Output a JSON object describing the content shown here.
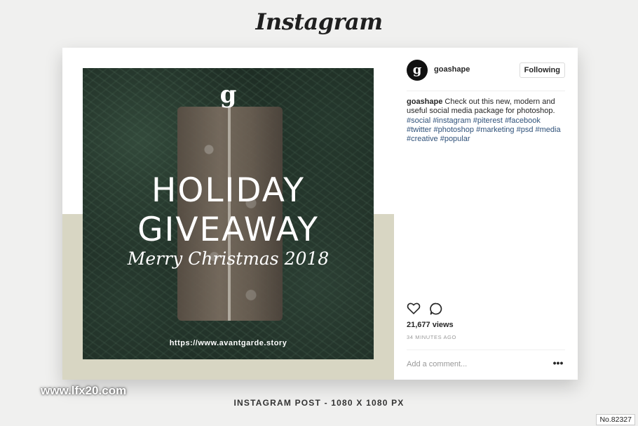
{
  "app": {
    "logo_text": "Instagram"
  },
  "post": {
    "image": {
      "brand_mark": "g",
      "headline_line1": "HOLIDAY",
      "headline_line2": "GIVEAWAY",
      "subline": "Merry Christmas 2018",
      "url": "https://www.avantgarde.story"
    },
    "author": {
      "avatar_letter": "g",
      "username": "goashape",
      "follow_label": "Following"
    },
    "caption": {
      "username": "goashape",
      "text": "Check out this new, modern and useful social media package for photoshop.",
      "hashtags": [
        "#social",
        "#instagram",
        "#piterest",
        "#facebook",
        "#twitter",
        "#photoshop",
        "#marketing",
        "#psd",
        "#media",
        "#creative",
        "#popular"
      ]
    },
    "actions": {
      "like_icon": "heart-icon",
      "comment_icon": "comment-icon"
    },
    "views": "21,677 views",
    "timestamp": "34 MINUTES AGO",
    "comment_placeholder": "Add a comment...",
    "more_label": "•••"
  },
  "footer": {
    "watermark": "www.lfx20.com",
    "caption": "INSTAGRAM POST - 1080 X 1080 PX",
    "stock_id": "No.82327"
  },
  "colors": {
    "background": "#f0f0ef",
    "band": "#d8d6c3",
    "hashtag": "#30527a",
    "text": "#262626"
  }
}
